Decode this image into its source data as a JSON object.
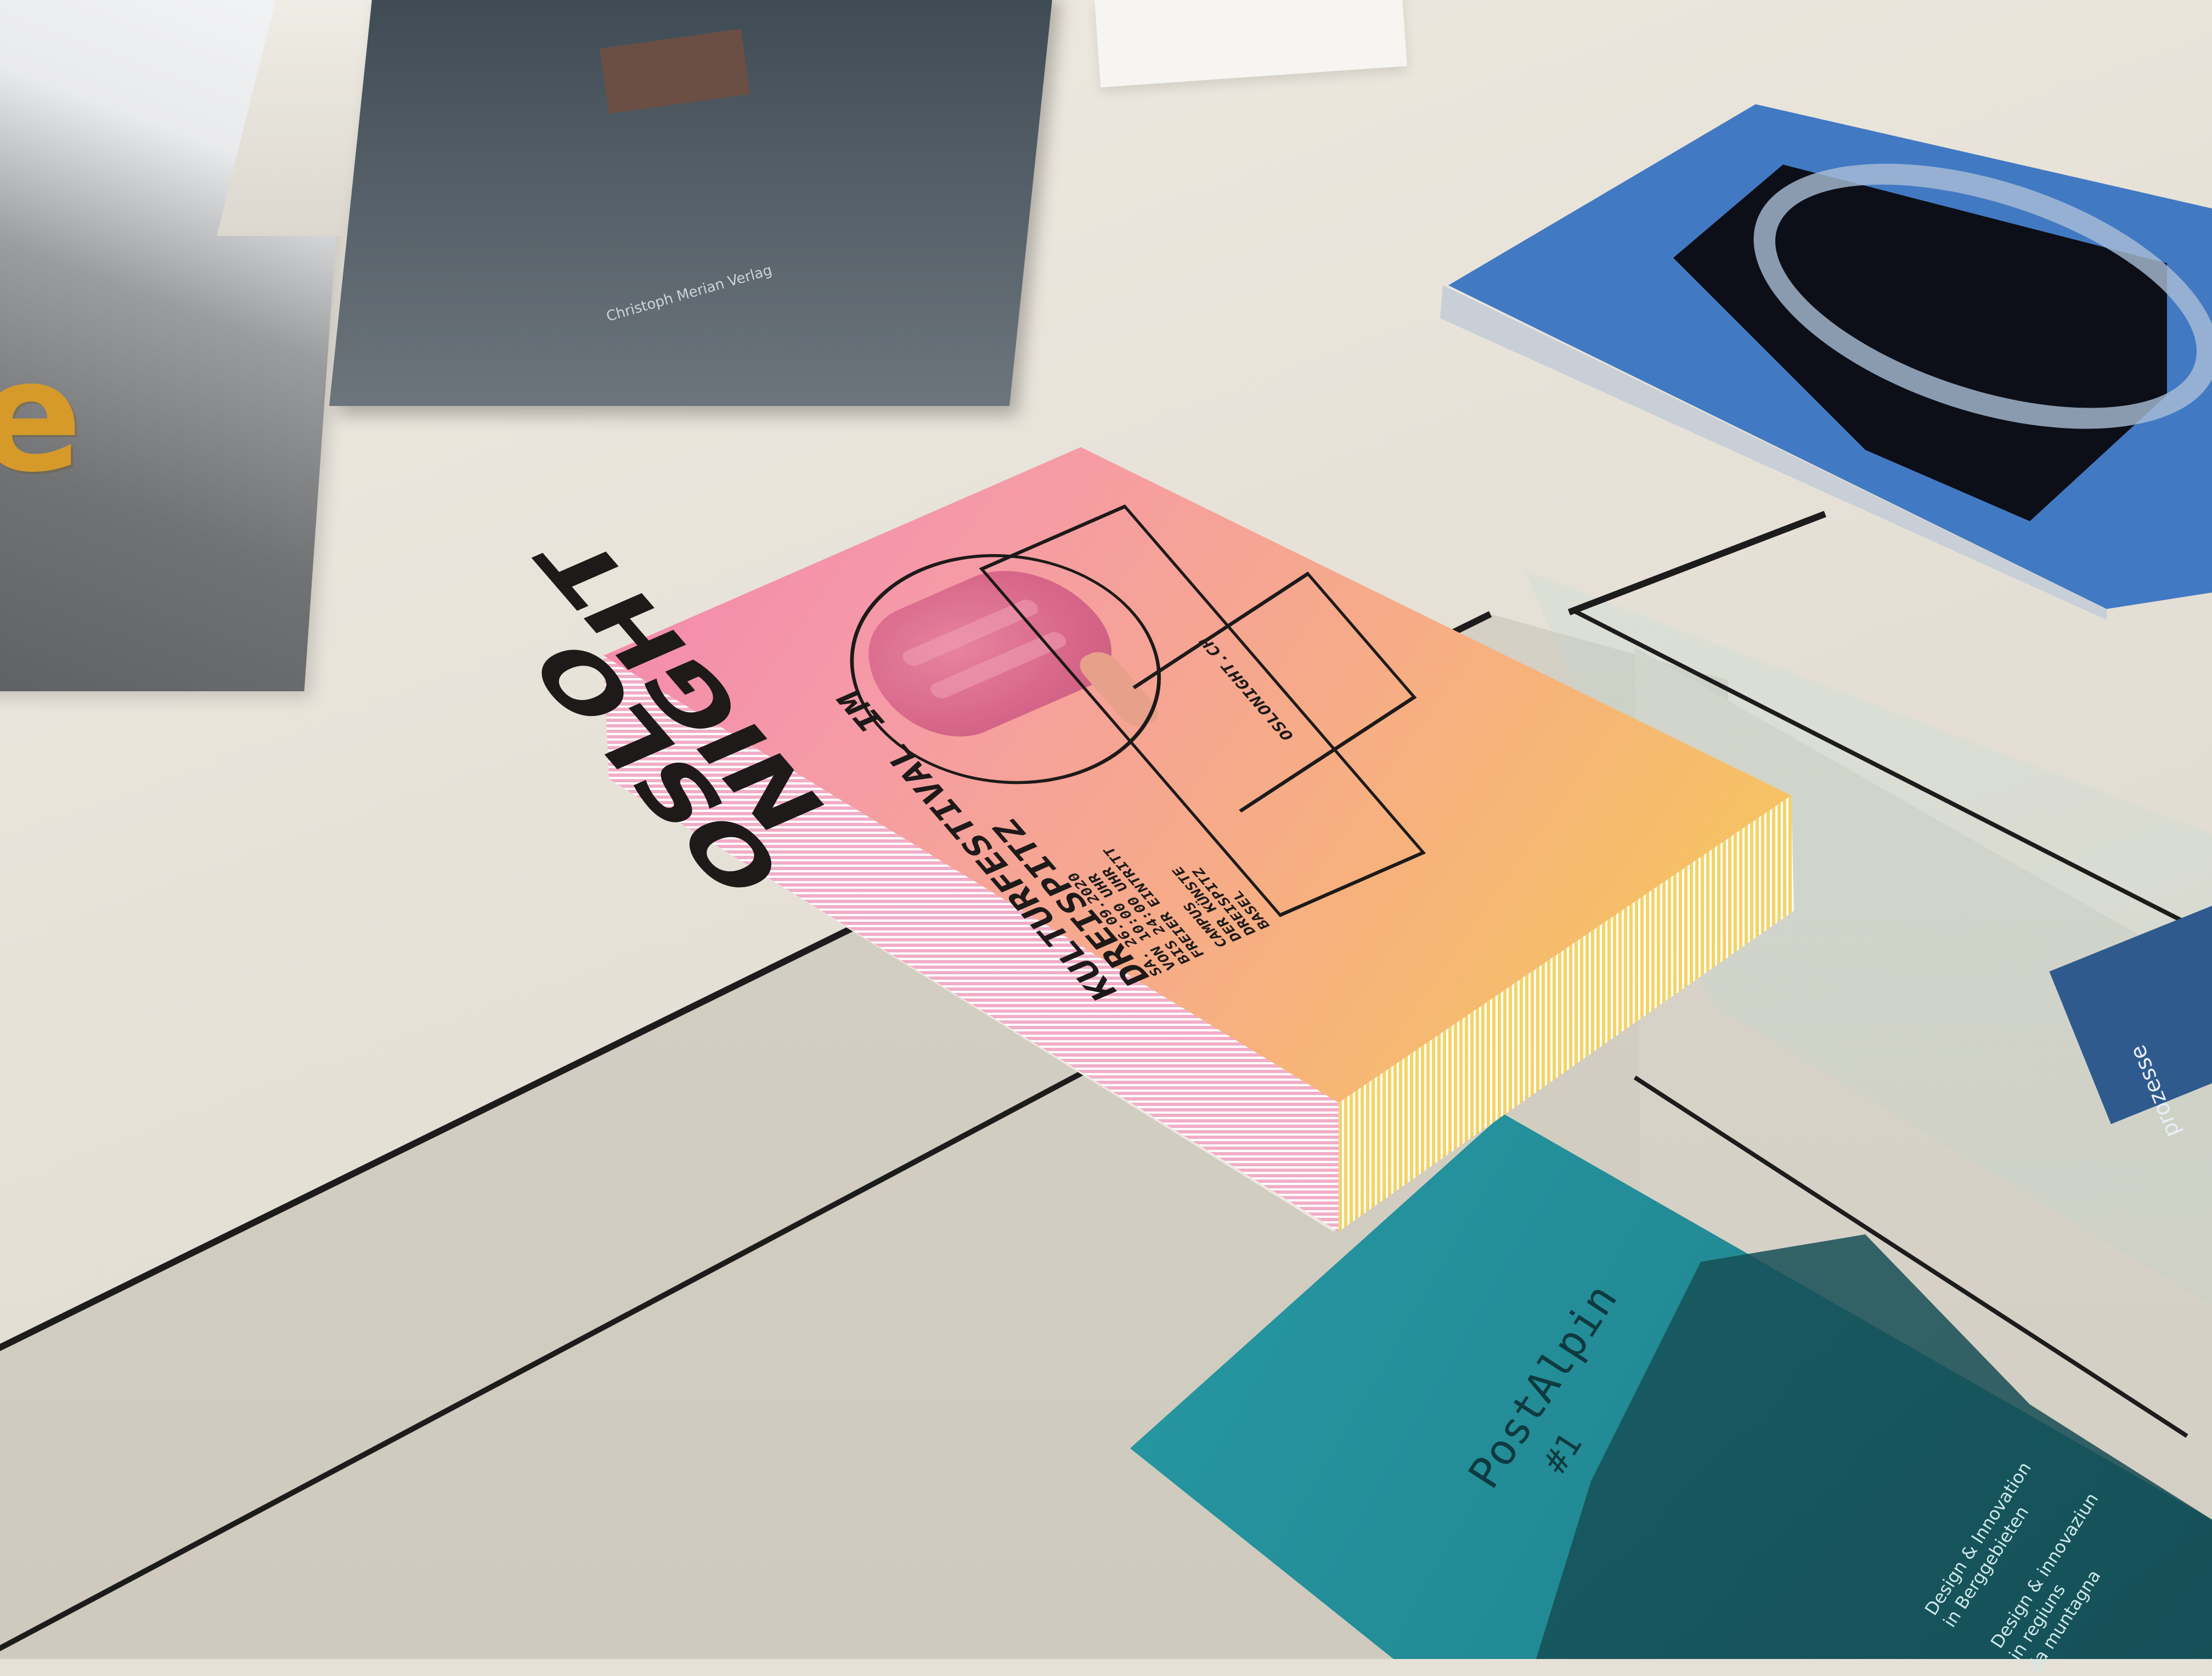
{
  "scene": {
    "description_colors": {
      "table": "#e6e1d7",
      "magazine_pink": "#f37ab3",
      "magazine_yellow": "#f4d24a",
      "teal_book": "#269aa4",
      "blue_magazine": "#4279c3"
    }
  },
  "oslo_night": {
    "title_line1": "OSLO",
    "title_line2": "NIGHT",
    "subtitle_line1": "KULTURFESTIVAL IM",
    "subtitle_line2": "DREISPITZ",
    "date": "SA. 26.09.2020",
    "time_from": "VON 10:00 UHR",
    "time_to": "BIS 24:00 UHR",
    "entry": "FREIER EINTRITT",
    "location": "CAMPUS\nDER KÜNSTE\nDREISPITZ\nBASEL",
    "url": "OSLONIGHT.CH"
  },
  "left_book": {
    "letter": "e"
  },
  "dark_book": {
    "spine_text": "Christoph Merian Verlag"
  },
  "post_alpin": {
    "title": "PostAlpin",
    "issue": "#1",
    "tagline_de": "Design & Innovation\nin Berggebieten",
    "tagline_rm": "Design & innovaziun\nin regiuns\nda muntagna"
  },
  "right_blue_book": {
    "spine_text": "prozesse"
  }
}
